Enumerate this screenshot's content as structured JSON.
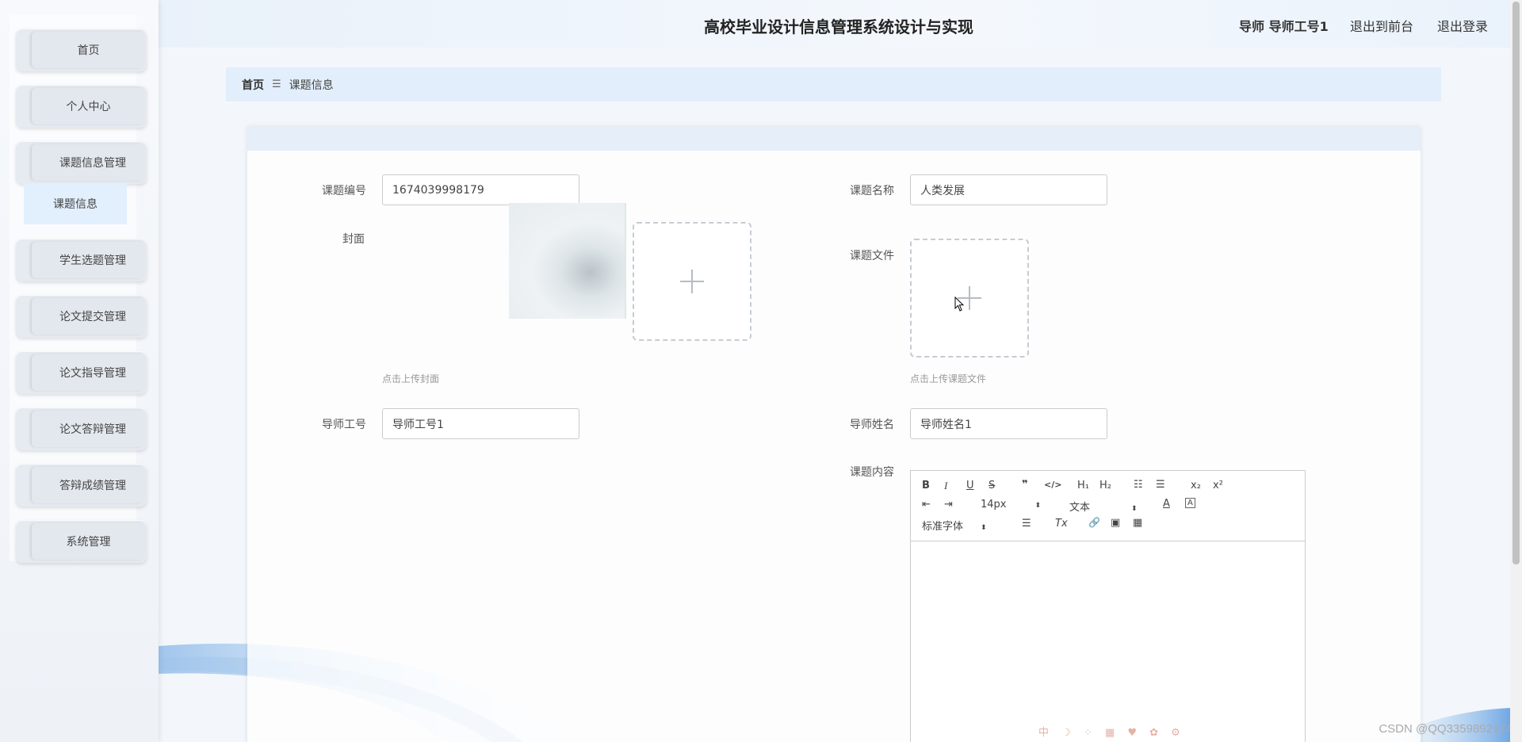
{
  "header": {
    "title": "高校毕业设计信息管理系统设计与实现",
    "user": "导师 导师工号1",
    "front_link": "退出到前台",
    "logout_link": "退出登录"
  },
  "sidebar": {
    "items": [
      {
        "label": "首页"
      },
      {
        "label": "个人中心"
      },
      {
        "label": "课题信息管理"
      },
      {
        "label": "学生选题管理"
      },
      {
        "label": "论文提交管理"
      },
      {
        "label": "论文指导管理"
      },
      {
        "label": "论文答辩管理"
      },
      {
        "label": "答辩成绩管理"
      },
      {
        "label": "系统管理"
      }
    ],
    "submenu": {
      "label": "课题信息"
    }
  },
  "breadcrumb": {
    "home": "首页",
    "separator": "☰",
    "current": "课题信息"
  },
  "form": {
    "topic_no": {
      "label": "课题编号",
      "value": "1674039998179"
    },
    "topic_name": {
      "label": "课题名称",
      "value": "人类发展"
    },
    "cover": {
      "label": "封面",
      "hint": "点击上传封面"
    },
    "topic_file": {
      "label": "课题文件",
      "hint": "点击上传课题文件"
    },
    "tutor_no": {
      "label": "导师工号",
      "value": "导师工号1"
    },
    "tutor_name": {
      "label": "导师姓名",
      "value": "导师姓名1"
    },
    "content": {
      "label": "课题内容"
    }
  },
  "editor": {
    "toolbar": {
      "bold": "B",
      "italic": "I",
      "underline": "U",
      "strike": "S",
      "quote": "❞",
      "code": "</>",
      "h1": "H₁",
      "h2": "H₂",
      "ordered": "☷",
      "bullet": "☰",
      "sub": "x₂",
      "sup": "x²",
      "outdent": "⇤",
      "indent": "⇥",
      "size": "14px",
      "header": "文本",
      "font": "标准字体",
      "color": "A",
      "background": "A",
      "align": "☰",
      "clean": "Tx",
      "link": "🔗",
      "image": "▣",
      "video": "▦"
    }
  },
  "watermark": "CSDN @QQ3359892174",
  "ime_bar": "中 ☽ ⁘ ▦ ♥ ✿ ⚙"
}
